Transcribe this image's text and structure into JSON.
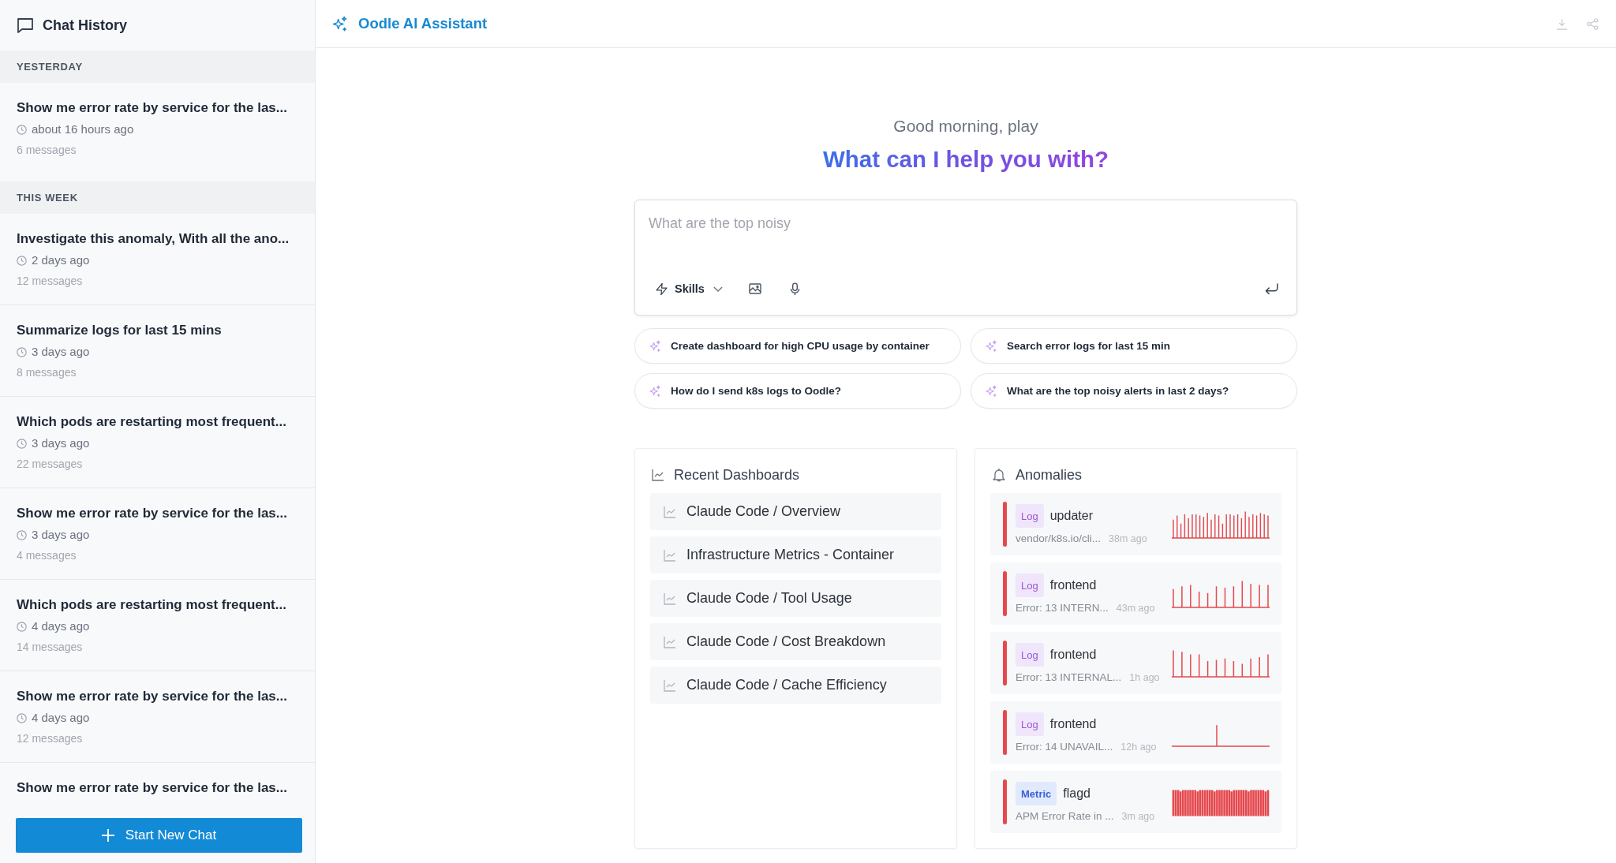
{
  "sidebar": {
    "title": "Chat History",
    "groups": [
      {
        "label": "YESTERDAY",
        "chats": [
          {
            "title": "Show me error rate by service for the las...",
            "time": "about 16 hours ago",
            "messages": "6 messages"
          }
        ]
      },
      {
        "label": "THIS WEEK",
        "chats": [
          {
            "title": "Investigate this anomaly, With all the ano...",
            "time": "2 days ago",
            "messages": "12 messages"
          },
          {
            "title": "Summarize logs for last 15 mins",
            "time": "3 days ago",
            "messages": "8 messages"
          },
          {
            "title": "Which pods are restarting most frequent...",
            "time": "3 days ago",
            "messages": "22 messages"
          },
          {
            "title": "Show me error rate by service for the las...",
            "time": "3 days ago",
            "messages": "4 messages"
          },
          {
            "title": "Which pods are restarting most frequent...",
            "time": "4 days ago",
            "messages": "14 messages"
          },
          {
            "title": "Show me error rate by service for the las...",
            "time": "4 days ago",
            "messages": "12 messages"
          },
          {
            "title": "Show me error rate by service for the las..."
          }
        ]
      }
    ],
    "new_chat_button": "Start New Chat"
  },
  "header": {
    "title": "Oodle AI Assistant"
  },
  "greeting": "Good morning, play",
  "heading": "What can I help you with?",
  "prompt": {
    "placeholder": "What are the top noisy",
    "skills_button": "Skills"
  },
  "suggestions": [
    "Create dashboard for high CPU usage by container",
    "Search error logs for last 15 min",
    "How do I send k8s logs to Oodle?",
    "What are the top noisy alerts in last 2 days?"
  ],
  "recent_dashboards": {
    "title": "Recent Dashboards",
    "items": [
      "Claude Code / Overview",
      "Infrastructure Metrics - Container",
      "Claude Code / Tool Usage",
      "Claude Code / Cost Breakdown",
      "Claude Code / Cache Efficiency"
    ]
  },
  "anomalies": {
    "title": "Anomalies",
    "items": [
      {
        "kind": "log",
        "badge": "Log",
        "name": "updater",
        "detail": "vendor/k8s.io/cli...",
        "time": "38m ago"
      },
      {
        "kind": "log",
        "badge": "Log",
        "name": "frontend",
        "detail": "Error: 13 INTERN...",
        "time": "43m ago"
      },
      {
        "kind": "log",
        "badge": "Log",
        "name": "frontend",
        "detail": "Error: 13 INTERNAL...",
        "time": "1h ago"
      },
      {
        "kind": "log",
        "badge": "Log",
        "name": "frontend",
        "detail": "Error: 14 UNAVAIL...",
        "time": "12h ago"
      },
      {
        "kind": "metric",
        "badge": "Metric",
        "name": "flagd",
        "detail": "APM Error Rate in ...",
        "time": "3m ago"
      }
    ]
  }
}
